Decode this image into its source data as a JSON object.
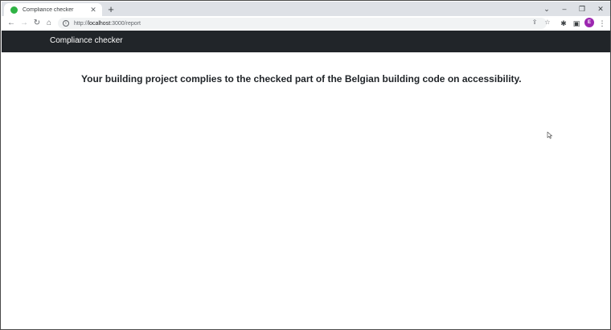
{
  "browser": {
    "tab_title": "Compliance checker",
    "new_tab": "+",
    "url_scheme": "http://",
    "url_host": "localhost",
    "url_path": ":3000/report",
    "avatar_letter": "E",
    "colors": {
      "tab_favicon": "#2fb344",
      "avatar": "#9c27b0"
    }
  },
  "navbar": {
    "brand": "Compliance checker",
    "background": "#212529"
  },
  "main": {
    "message": "Your building project complies to the checked part of the Belgian building code on accessibility."
  }
}
